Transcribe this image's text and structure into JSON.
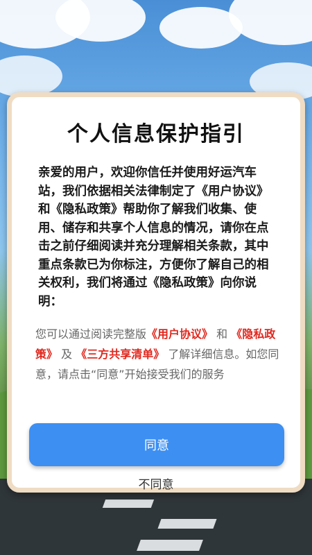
{
  "dialog": {
    "title": "个人信息保护指引",
    "intro": "亲爱的用户，欢迎你信任并使用好运汽车站，我们依据相关法律制定了《用户协议》和《隐私政策》帮助你了解我们收集、使用、储存和共享个人信息的情况，请你在点击之前仔细阅读并充分理解相关条款，其中重点条款已为你标注，方便你了解自己的相关权利，我们将通过《隐私政策》向你说明：",
    "note": {
      "part1": "您可以通过阅读完整版",
      "link_user_agreement": "《用户协议》",
      "part2": "和",
      "link_privacy": "《隐私政策》",
      "part3": "及",
      "link_third_party": "《三方共享清单》",
      "part4": "了解详细信息。如您同意，请点击“同意”开始接受我们的服务"
    },
    "agree_label": "同意",
    "disagree_label": "不同意"
  },
  "colors": {
    "accent": "#3d8ff2",
    "link": "#e0281e",
    "border": "#efdcc3"
  }
}
